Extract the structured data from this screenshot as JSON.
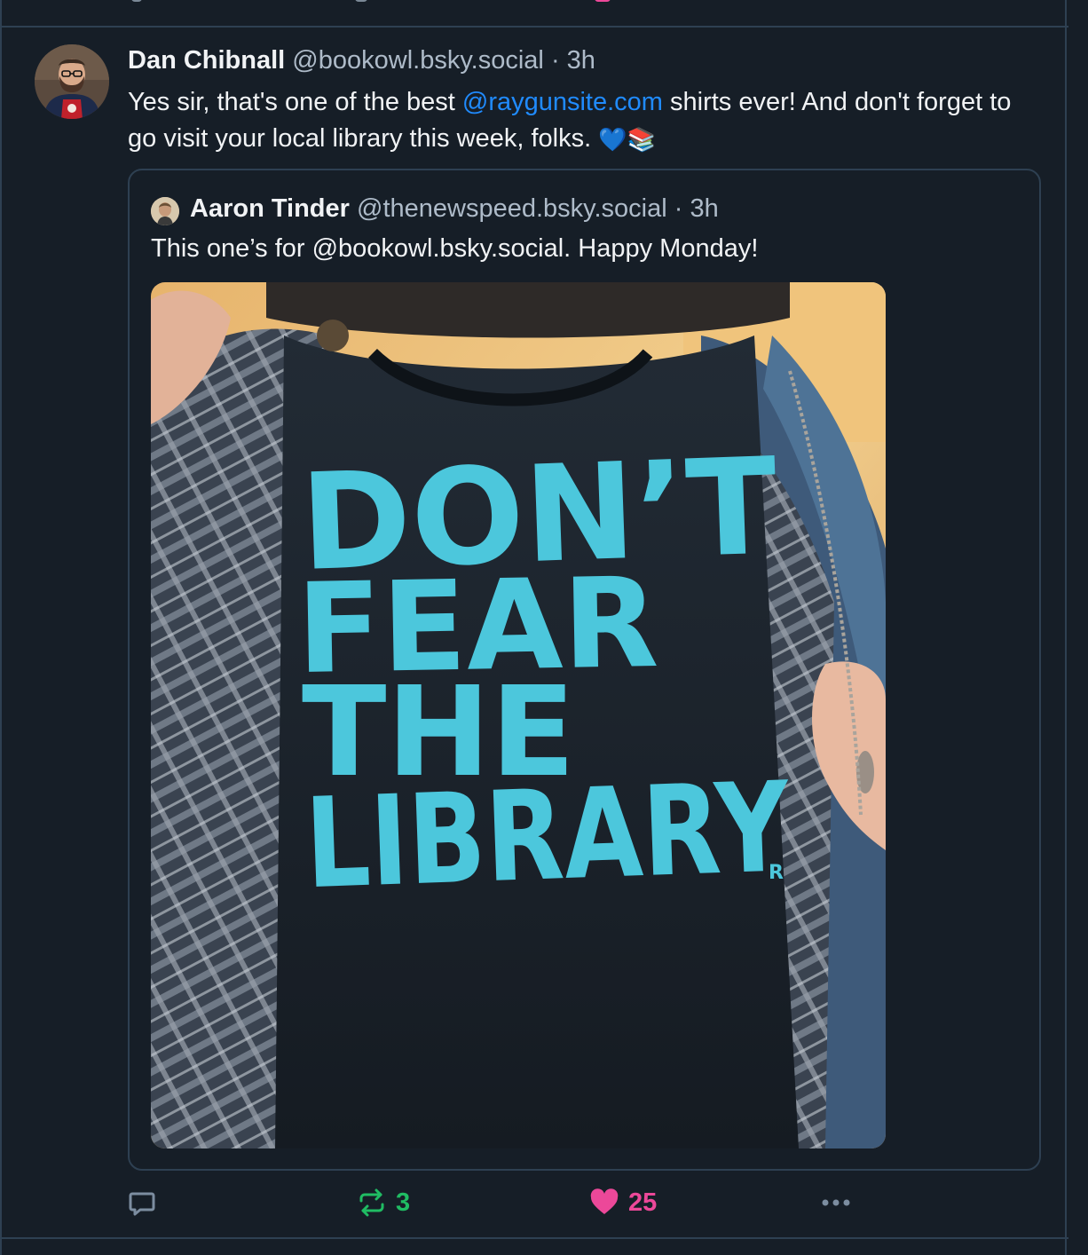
{
  "post": {
    "author_name": "Dan Chibnall",
    "handle": "@bookowl.bsky.social",
    "separator": "·",
    "time": "3h",
    "text_before": "Yes sir, that's one of the best ",
    "mention": "@raygunsite.com",
    "text_after": " shirts ever! And don't forget to go visit your local library this week, folks. ",
    "emoji": "💙📚"
  },
  "quote": {
    "author_name": "Aaron Tinder",
    "handle": "@thenewspeed.bsky.social",
    "separator": "·",
    "time": "3h",
    "text": "This one’s for @bookowl.bsky.social. Happy Monday!",
    "image": {
      "shirt_lines": [
        "DON’T",
        "FEAR",
        "THE",
        "LIBRARY"
      ],
      "trademark": "R"
    }
  },
  "actions": {
    "reply": {
      "icon": "speech-bubble-icon"
    },
    "repost": {
      "icon": "repost-arrows-icon",
      "count": "3",
      "color": "#20bc63"
    },
    "like": {
      "icon": "heart-icon",
      "count": "25",
      "color": "#ec4899"
    },
    "more": {
      "icon": "ellipsis-icon"
    }
  },
  "colors": {
    "background": "#161e27",
    "border": "#2e4052",
    "link": "#208bfe",
    "muted_text": "#aebbc9",
    "shirt_print": "#4cc7dc"
  }
}
